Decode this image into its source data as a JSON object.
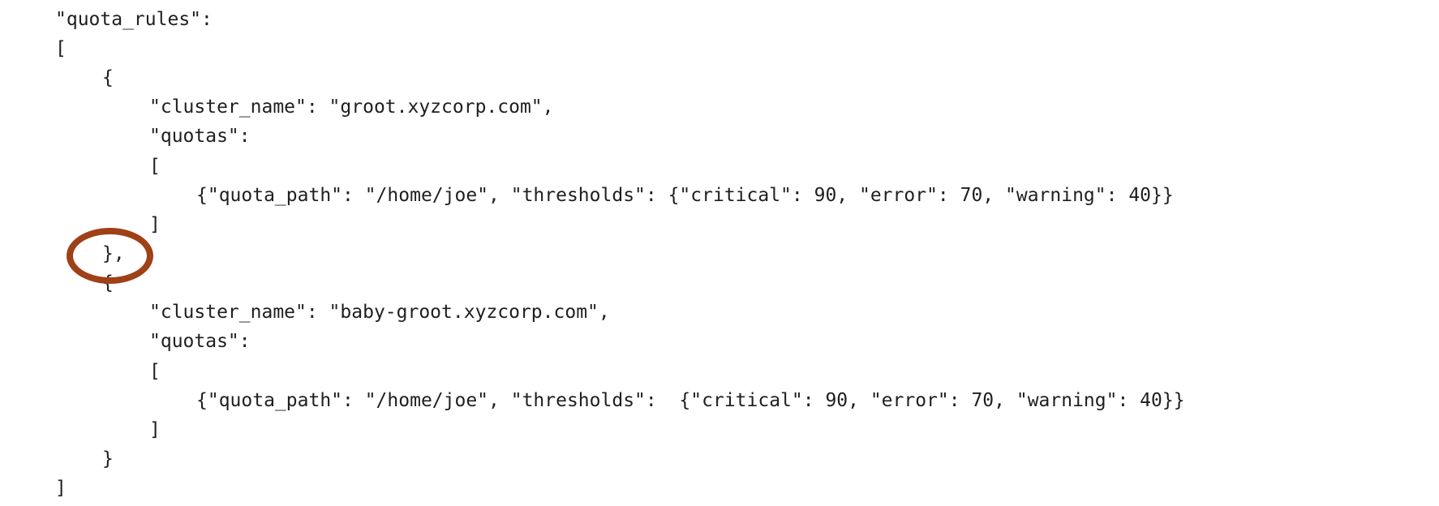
{
  "code": {
    "lines": [
      "\"quota_rules\":",
      "[",
      "{",
      "\"cluster_name\": \"groot.xyzcorp.com\",",
      "\"quotas\":",
      "[",
      "{\"quota_path\": \"/home/joe\", \"thresholds\": {\"critical\": 90, \"error\": 70, \"warning\": 40}}",
      "]",
      "},",
      "{",
      "\"cluster_name\": \"baby-groot.xyzcorp.com\",",
      "\"quotas\":",
      "[",
      "{\"quota_path\": \"/home/joe\", \"thresholds\":  {\"critical\": 90, \"error\": 70, \"warning\": 40}}",
      "]",
      "}",
      "]"
    ]
  },
  "annotation": {
    "shape": "circle",
    "color": "#9f4017",
    "target_line": 8
  }
}
